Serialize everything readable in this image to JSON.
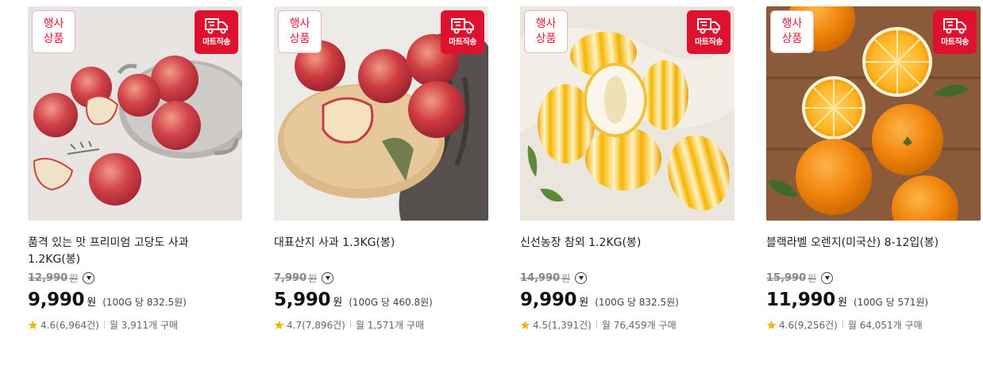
{
  "products": [
    {
      "event_badge": "행사\n상품",
      "ship_badge": "마트직송",
      "name": "품격 있는 맛 프리미엄 고당도 사과 1.2KG(봉)",
      "original_price": "12,990",
      "currency": "원",
      "price": "9,990",
      "unit_price": "(100G 당 832.5원)",
      "rating": "4.6(6,964건)",
      "monthly": "월 3,911개 구매"
    },
    {
      "event_badge": "행사\n상품",
      "ship_badge": "마트직송",
      "name": "대표산지 사과 1.3KG(봉)",
      "original_price": "7,990",
      "currency": "원",
      "price": "5,990",
      "unit_price": "(100G 당 460.8원)",
      "rating": "4.7(7,896건)",
      "monthly": "월 1,571개 구매"
    },
    {
      "event_badge": "행사\n상품",
      "ship_badge": "마트직송",
      "name": "신선농장 참외 1.2KG(봉)",
      "original_price": "14,990",
      "currency": "원",
      "price": "9,990",
      "unit_price": "(100G 당 832.5원)",
      "rating": "4.5(1,391건)",
      "monthly": "월 76,459개 구매"
    },
    {
      "event_badge": "행사\n상품",
      "ship_badge": "마트직송",
      "name": "블랙라벨 오렌지(미국산) 8-12입(봉)",
      "original_price": "15,990",
      "currency": "원",
      "price": "11,990",
      "unit_price": "(100G 당 571원)",
      "rating": "4.6(9,256건)",
      "monthly": "월 64,051개 구매"
    }
  ],
  "colors": {
    "accent": "#e0102f",
    "star": "#f5b400"
  },
  "icons": {
    "ship": "delivery-truck-icon",
    "star": "star-icon",
    "dropdown": "chevron-down-icon"
  }
}
